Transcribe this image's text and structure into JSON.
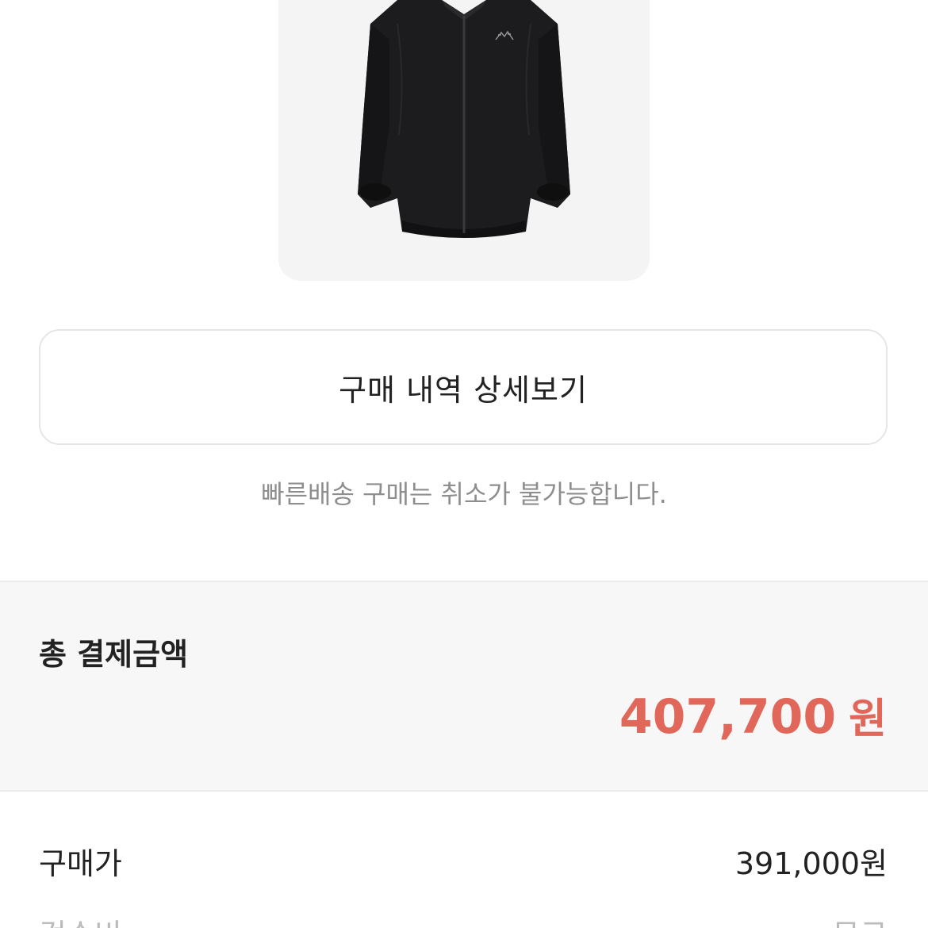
{
  "product": {
    "brand_mark": "ARC'TERYX",
    "icon": "jacket-image"
  },
  "detail_button": {
    "label": "구매 내역 상세보기"
  },
  "notice": {
    "text": "빠른배송 구매는 취소가 불가능합니다."
  },
  "total": {
    "label": "총 결제금액",
    "amount": "407,700",
    "unit": "원",
    "color": "#e0675a"
  },
  "breakdown": [
    {
      "label": "구매가",
      "value": "391,000원"
    },
    {
      "label": "검수비",
      "value": "무료"
    }
  ]
}
